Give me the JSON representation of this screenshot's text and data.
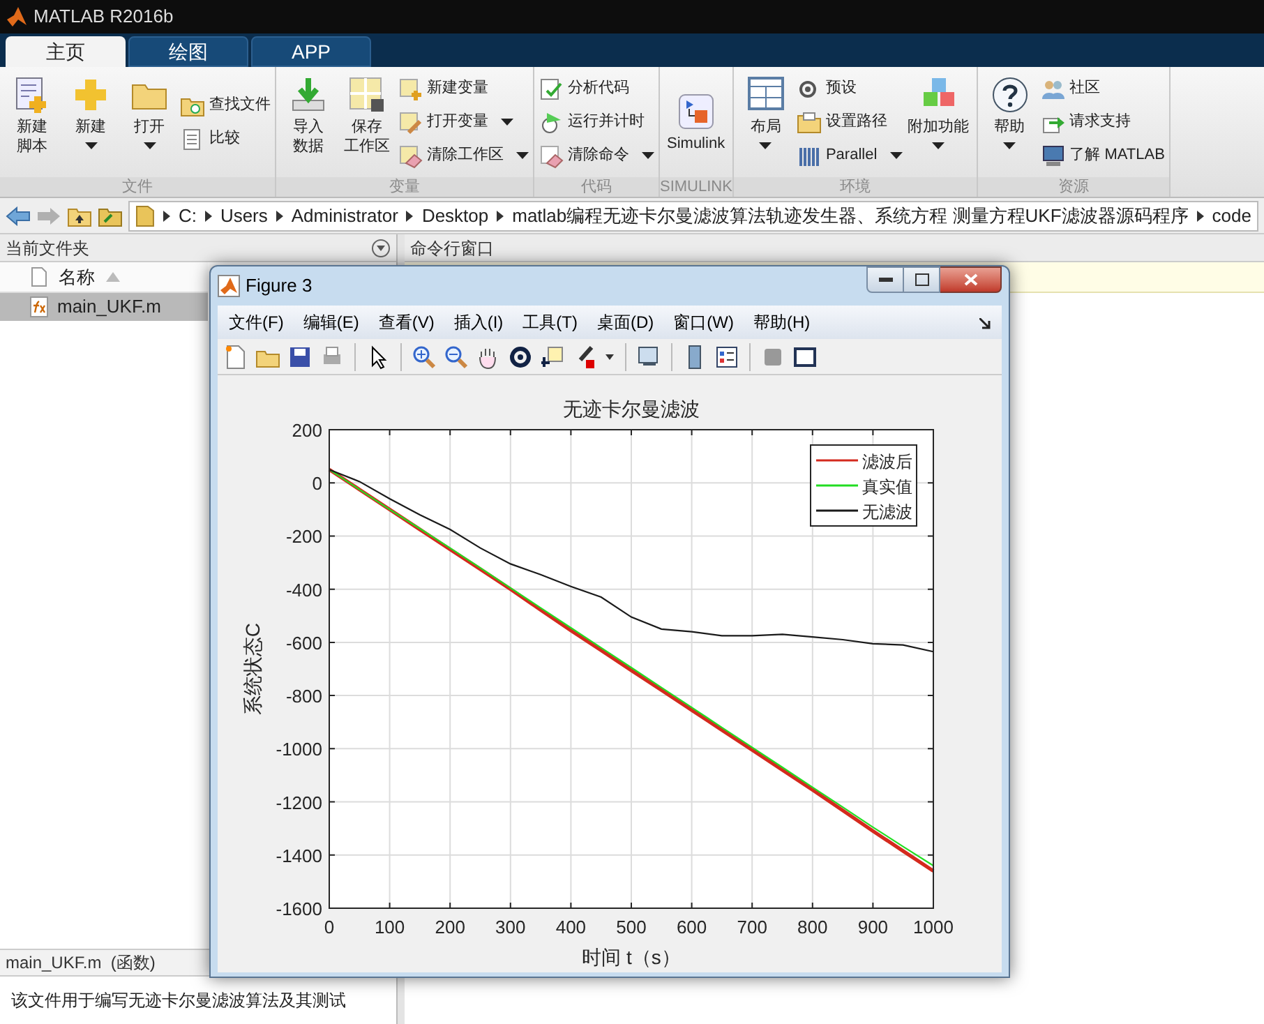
{
  "window": {
    "title": "MATLAB R2016b"
  },
  "tabs": [
    {
      "label": "主页",
      "selected": true
    },
    {
      "label": "绘图",
      "selected": false
    },
    {
      "label": "APP",
      "selected": false
    }
  ],
  "toolstrip": {
    "groups": [
      {
        "label": "文件",
        "items": [
          {
            "kind": "large",
            "lines": [
              "新建",
              "脚本"
            ],
            "dropdown": false
          },
          {
            "kind": "large",
            "lines": [
              "新建"
            ],
            "dropdown": true
          },
          {
            "kind": "large",
            "lines": [
              "打开"
            ],
            "dropdown": true
          },
          {
            "kind": "small",
            "lines": [
              "查找文件"
            ],
            "dropdown": false
          },
          {
            "kind": "small",
            "lines": [
              "比较"
            ],
            "dropdown": false
          }
        ]
      },
      {
        "label": "变量",
        "items": [
          {
            "kind": "large",
            "lines": [
              "导入",
              "数据"
            ],
            "dropdown": false
          },
          {
            "kind": "large",
            "lines": [
              "保存",
              "工作区"
            ],
            "dropdown": false
          },
          {
            "kind": "small",
            "lines": [
              "新建变量"
            ],
            "dropdown": false
          },
          {
            "kind": "small",
            "lines": [
              "打开变量"
            ],
            "dropdown": true
          },
          {
            "kind": "small",
            "lines": [
              "清除工作区"
            ],
            "dropdown": true
          }
        ]
      },
      {
        "label": "代码",
        "items": [
          {
            "kind": "small",
            "lines": [
              "分析代码"
            ],
            "dropdown": false
          },
          {
            "kind": "small",
            "lines": [
              "运行并计时"
            ],
            "dropdown": false
          },
          {
            "kind": "small",
            "lines": [
              "清除命令"
            ],
            "dropdown": true
          }
        ]
      },
      {
        "label": "SIMULINK",
        "items": [
          {
            "kind": "large",
            "lines": [
              "Simulink"
            ],
            "dropdown": false
          }
        ]
      },
      {
        "label": "环境",
        "items": [
          {
            "kind": "large",
            "lines": [
              "布局"
            ],
            "dropdown": true
          },
          {
            "kind": "small",
            "lines": [
              "预设"
            ],
            "dropdown": false
          },
          {
            "kind": "small",
            "lines": [
              "设置路径"
            ],
            "dropdown": false
          },
          {
            "kind": "small",
            "lines": [
              "Parallel"
            ],
            "dropdown": true
          },
          {
            "kind": "large",
            "lines": [
              "附加功能"
            ],
            "dropdown": true
          }
        ]
      },
      {
        "label": "资源",
        "items": [
          {
            "kind": "large",
            "lines": [
              "帮助"
            ],
            "dropdown": true
          },
          {
            "kind": "small",
            "lines": [
              "社区"
            ],
            "dropdown": false
          },
          {
            "kind": "small",
            "lines": [
              "请求支持"
            ],
            "dropdown": false
          },
          {
            "kind": "small",
            "lines": [
              "了解 MATLAB"
            ],
            "dropdown": false
          }
        ]
      }
    ]
  },
  "address_bar": {
    "segments": [
      "C:",
      "Users",
      "Administrator",
      "Desktop",
      "matlab编程无迹卡尔曼滤波算法轨迹发生器、系统方程 测量方程UKF滤波器源码程序",
      "code"
    ]
  },
  "current_folder": {
    "title": "当前文件夹",
    "column": "名称",
    "files": [
      {
        "name": "main_UKF.m",
        "selected": true
      }
    ],
    "details": {
      "title": "main_UKF.m  (函数)",
      "description": "该文件用于编写无迹卡尔曼滤波算法及其测试"
    }
  },
  "command_window": {
    "title": "命令行窗口"
  },
  "figure": {
    "title": "Figure 3",
    "menu": [
      "文件(F)",
      "编辑(E)",
      "查看(V)",
      "插入(I)",
      "工具(T)",
      "桌面(D)",
      "窗口(W)",
      "帮助(H)"
    ],
    "chart_data": {
      "type": "line",
      "title": "无迹卡尔曼滤波",
      "xlabel": "时间 t（s）",
      "ylabel": "系统状态C",
      "x": [
        0,
        50,
        100,
        150,
        200,
        250,
        300,
        350,
        400,
        450,
        500,
        550,
        600,
        650,
        700,
        750,
        800,
        850,
        900,
        950,
        1000
      ],
      "series": [
        {
          "name": "滤波后",
          "color": "#d42a1e",
          "values": [
            50,
            -25,
            -100,
            -175,
            -250,
            -325,
            -400,
            -478,
            -555,
            -630,
            -705,
            -780,
            -855,
            -930,
            -1005,
            -1080,
            -1155,
            -1232,
            -1310,
            -1385,
            -1460
          ]
        },
        {
          "name": "真实值",
          "color": "#22dd22",
          "values": [
            50,
            -25,
            -100,
            -172,
            -245,
            -320,
            -395,
            -470,
            -545,
            -620,
            -695,
            -770,
            -845,
            -920,
            -995,
            -1070,
            -1145,
            -1220,
            -1295,
            -1368,
            -1440
          ]
        },
        {
          "name": "无滤波",
          "color": "#1a1a1a",
          "values": [
            50,
            5,
            -60,
            -120,
            -175,
            -245,
            -305,
            -345,
            -390,
            -430,
            -505,
            -550,
            -560,
            -575,
            -575,
            -570,
            -580,
            -590,
            -605,
            -610,
            -635
          ]
        }
      ],
      "xlim": [
        0,
        1000
      ],
      "ylim": [
        -1600,
        200
      ],
      "grid": true,
      "legend": true,
      "xticks": [
        0,
        100,
        200,
        300,
        400,
        500,
        600,
        700,
        800,
        900,
        1000
      ],
      "yticks": [
        -1600,
        -1400,
        -1200,
        -1000,
        -800,
        -600,
        -400,
        -200,
        0,
        200
      ]
    }
  }
}
